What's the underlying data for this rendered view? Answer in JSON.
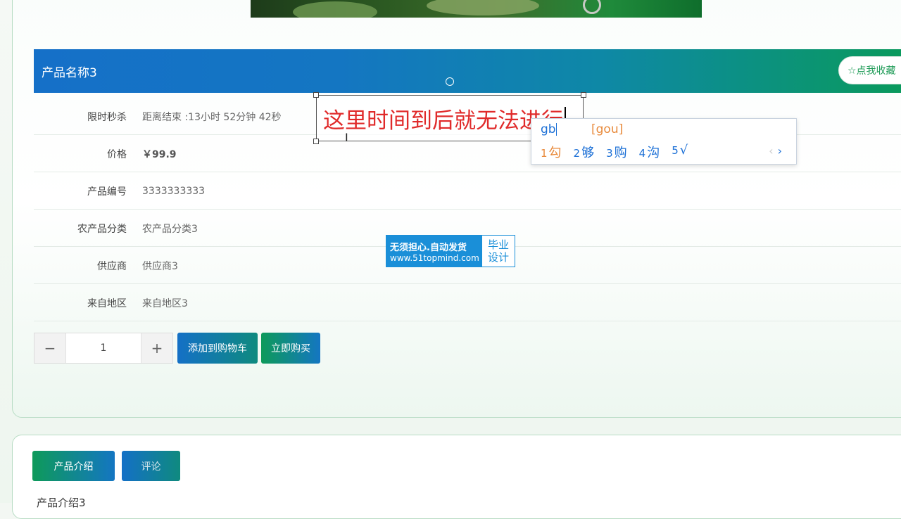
{
  "product": {
    "name": "产品名称3",
    "favorite_label": "☆点我收藏"
  },
  "details": [
    {
      "label": "限时秒杀",
      "value": "距离结束 :13小时 52分钟 42秒"
    },
    {
      "label": "价格",
      "value": "￥99.9"
    },
    {
      "label": "产品编号",
      "value": "3333333333"
    },
    {
      "label": "农产品分类",
      "value": "农产品分类3"
    },
    {
      "label": "供应商",
      "value": "供应商3"
    },
    {
      "label": "来自地区",
      "value": "来自地区3"
    }
  ],
  "quantity": {
    "minus": "−",
    "value": "1",
    "plus": "+"
  },
  "actions": {
    "add_to_cart": "添加到购物车",
    "buy_now": "立即购买"
  },
  "annotation": {
    "text": "这里时间到后就无法进行"
  },
  "ime": {
    "input": "gb",
    "pinyin": "[gou]",
    "candidates": [
      {
        "n": "1",
        "c": "勾"
      },
      {
        "n": "2",
        "c": "够"
      },
      {
        "n": "3",
        "c": "购"
      },
      {
        "n": "4",
        "c": "沟"
      },
      {
        "n": "5",
        "c": "√"
      }
    ],
    "prev": "‹",
    "next": "›"
  },
  "watermark": {
    "line1": "无须担心.自动发货",
    "line2": "www.51topmind.com",
    "right1": "毕业",
    "right2": "设计"
  },
  "tabs": {
    "intro": "产品介绍",
    "comment": "评论"
  },
  "intro_text": "产品介绍3"
}
